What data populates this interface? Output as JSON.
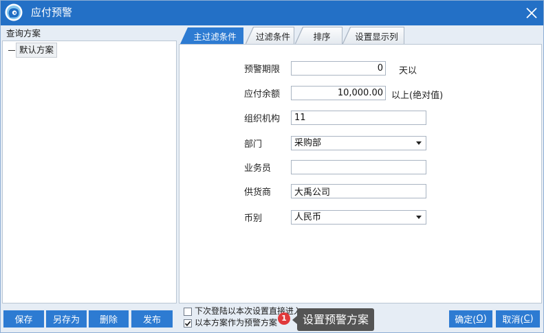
{
  "window": {
    "title": "应付预警"
  },
  "left_panel": {
    "header": "查询方案",
    "tree_items": [
      {
        "label": "默认方案"
      }
    ]
  },
  "tabs": [
    {
      "label": "主过滤条件",
      "active": true
    },
    {
      "label": "过滤条件",
      "active": false
    },
    {
      "label": "排序",
      "active": false
    },
    {
      "label": "设置显示列",
      "active": false
    }
  ],
  "form": {
    "warning_period": {
      "label": "预警期限",
      "value": "0",
      "suffix": "天以"
    },
    "payable_balance": {
      "label": "应付余额",
      "value": "10,000.00",
      "suffix": "以上(绝对值)"
    },
    "organization": {
      "label": "组织机构",
      "value": "11"
    },
    "department": {
      "label": "部门",
      "value": "采购部"
    },
    "salesperson": {
      "label": "业务员",
      "value": ""
    },
    "supplier": {
      "label": "供货商",
      "value": "大禹公司"
    },
    "currency": {
      "label": "币别",
      "value": "人民币"
    }
  },
  "scheme_buttons": {
    "save": "保存",
    "save_as": "另存为",
    "delete": "删除",
    "publish": "发布"
  },
  "options": [
    {
      "label": "下次登陆以本次设置直接进入",
      "checked": false
    },
    {
      "label": "以本方案作为预警方案",
      "checked": true
    }
  ],
  "step_badge": "1",
  "tooltip": "设置预警方案",
  "dialog_buttons": {
    "ok": {
      "prefix": "确定(",
      "key": "O",
      "suffix": ")"
    },
    "cancel": {
      "prefix": "取消(",
      "key": "C",
      "suffix": ")"
    }
  },
  "colors": {
    "title_bar": "#2370c6",
    "accent": "#2d7bd2",
    "badge": "#e0393b",
    "tooltip": "#545454"
  },
  "icons": {
    "app": "app-logo-icon",
    "close": "close-icon",
    "dropdown": "chevron-down-icon",
    "checkmark": "checkmark-icon"
  }
}
